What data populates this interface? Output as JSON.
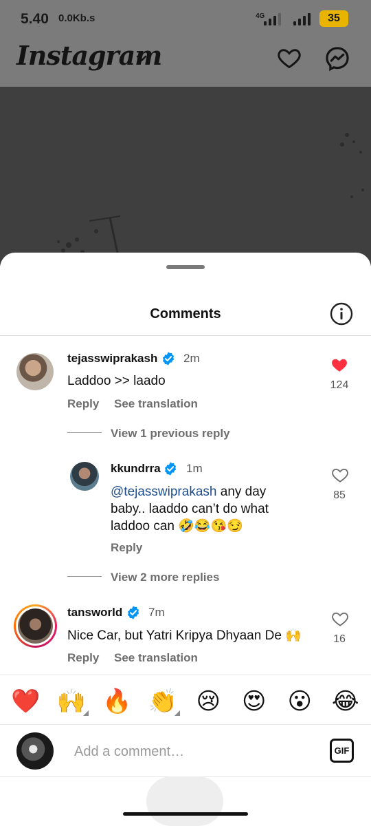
{
  "status_bar": {
    "time": "5.40",
    "speed": "0.0Kb.s",
    "network": "4G",
    "battery": "35"
  },
  "header": {
    "logo": "Instagram",
    "icons": [
      "chevron-down-icon",
      "heart-icon",
      "messenger-icon"
    ]
  },
  "sheet": {
    "title": "Comments"
  },
  "comments": [
    {
      "username": "tejasswiprakash",
      "verified": true,
      "time": "2m",
      "text": "Laddoo >> laado",
      "reply_label": "Reply",
      "translate_label": "See translation",
      "liked": true,
      "likes": "124",
      "view_replies": "View 1 previous reply"
    },
    {
      "username": "kkundrra",
      "verified": true,
      "time": "1m",
      "mention": "@tejasswiprakash",
      "text_line1": " any day",
      "text_line2": "baby.. laaddo can’t do what",
      "text_line3": "laddoo can 🤣😂😘😏",
      "reply_label": "Reply",
      "liked": false,
      "likes": "85",
      "view_replies": "View 2 more replies"
    },
    {
      "username": "tansworld",
      "verified": true,
      "time": "7m",
      "text": "Nice Car, but Yatri Kripya Dhyaan De 🙌",
      "reply_label": "Reply",
      "translate_label": "See translation",
      "liked": false,
      "likes": "16"
    }
  ],
  "emoji_bar": [
    "❤️",
    "🙌",
    "🔥",
    "👏",
    "😢",
    "😍",
    "😮",
    "😂"
  ],
  "composer": {
    "placeholder": "Add a comment…",
    "gif_label": "GIF"
  },
  "colors": {
    "like_red": "#ff3040",
    "verified_blue": "#0095f6",
    "mention_blue": "#1f4e8c"
  }
}
